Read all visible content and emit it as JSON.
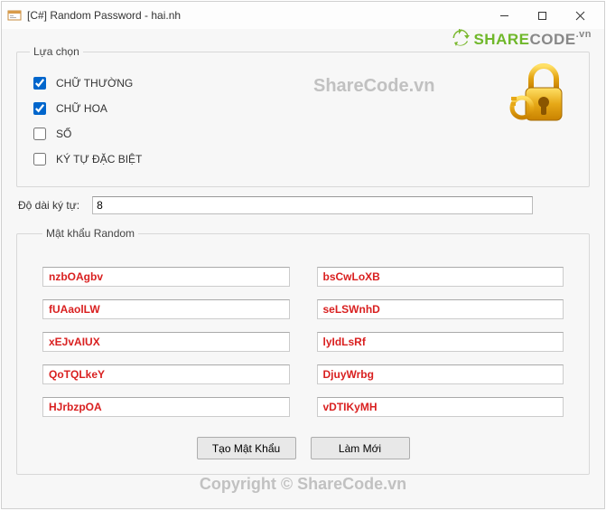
{
  "window": {
    "title": "[C#] Random Password - hai.nh"
  },
  "brand": {
    "share": "SHARE",
    "code": "CODE",
    "vn": ".vn"
  },
  "watermark_top": "ShareCode.vn",
  "options": {
    "legend": "Lựa chọn",
    "items": [
      {
        "label": "CHỮ THƯỜNG",
        "checked": true
      },
      {
        "label": "CHỮ HOA",
        "checked": true
      },
      {
        "label": "SỐ",
        "checked": false
      },
      {
        "label": "KÝ TỰ ĐẶC BIỆT",
        "checked": false
      }
    ]
  },
  "length": {
    "label": "Độ dài ký tự:",
    "value": "8"
  },
  "results": {
    "legend": "Mật khẩu Random",
    "left": [
      "nzbOAgbv",
      "fUAaolLW",
      "xEJvAIUX",
      "QoTQLkeY",
      "HJrbzpOA"
    ],
    "right": [
      "bsCwLoXB",
      "seLSWnhD",
      "lyIdLsRf",
      "DjuyWrbg",
      "vDTIKyMH"
    ]
  },
  "buttons": {
    "generate": "Tạo Mật Khẩu",
    "reset": "Làm Mới"
  },
  "copyright": "Copyright © ShareCode.vn"
}
